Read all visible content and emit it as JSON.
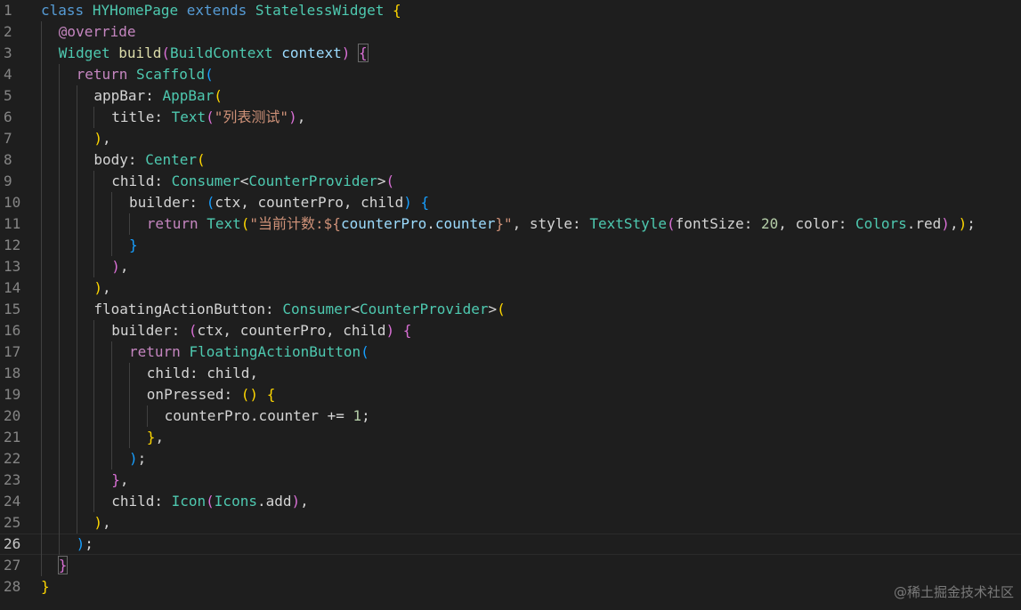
{
  "editor": {
    "language": "dart",
    "current_line": 26,
    "colors": {
      "background": "#1e1e1e",
      "keyword": "#569cd6",
      "control": "#c586c0",
      "type": "#4ec9b0",
      "function": "#dcdcaa",
      "parameter": "#9cdcfe",
      "string": "#ce9178",
      "number": "#b5cea8",
      "bracket_level_1": "#ffd700",
      "bracket_level_2": "#da70d6",
      "bracket_level_3": "#179fff"
    },
    "lines": [
      {
        "number": "1",
        "indent": 0,
        "tokens": [
          [
            "kw",
            "class"
          ],
          [
            "plain",
            " "
          ],
          [
            "type",
            "HYHomePage"
          ],
          [
            "plain",
            " "
          ],
          [
            "kw",
            "extends"
          ],
          [
            "plain",
            " "
          ],
          [
            "type",
            "StatelessWidget"
          ],
          [
            "plain",
            " "
          ],
          [
            "b1",
            "{"
          ]
        ]
      },
      {
        "number": "2",
        "indent": 1,
        "tokens": [
          [
            "ann",
            "@override"
          ]
        ]
      },
      {
        "number": "3",
        "indent": 1,
        "tokens": [
          [
            "type",
            "Widget"
          ],
          [
            "plain",
            " "
          ],
          [
            "fn",
            "build"
          ],
          [
            "b2",
            "("
          ],
          [
            "type",
            "BuildContext"
          ],
          [
            "plain",
            " "
          ],
          [
            "param",
            "context"
          ],
          [
            "b2",
            ")"
          ],
          [
            "plain",
            " "
          ],
          [
            "b2m",
            "{"
          ]
        ]
      },
      {
        "number": "4",
        "indent": 2,
        "tokens": [
          [
            "ctl",
            "return"
          ],
          [
            "plain",
            " "
          ],
          [
            "type",
            "Scaffold"
          ],
          [
            "b3",
            "("
          ]
        ]
      },
      {
        "number": "5",
        "indent": 3,
        "tokens": [
          [
            "plain",
            "appBar: "
          ],
          [
            "type",
            "AppBar"
          ],
          [
            "b1",
            "("
          ]
        ]
      },
      {
        "number": "6",
        "indent": 4,
        "tokens": [
          [
            "plain",
            "title: "
          ],
          [
            "type",
            "Text"
          ],
          [
            "b2",
            "("
          ],
          [
            "str",
            "\"列表测试\""
          ],
          [
            "b2",
            ")"
          ],
          [
            "plain",
            ","
          ]
        ]
      },
      {
        "number": "7",
        "indent": 3,
        "tokens": [
          [
            "b1",
            ")"
          ],
          [
            "plain",
            ","
          ]
        ]
      },
      {
        "number": "8",
        "indent": 3,
        "tokens": [
          [
            "plain",
            "body: "
          ],
          [
            "type",
            "Center"
          ],
          [
            "b1",
            "("
          ]
        ]
      },
      {
        "number": "9",
        "indent": 4,
        "tokens": [
          [
            "plain",
            "child: "
          ],
          [
            "type",
            "Consumer"
          ],
          [
            "plain",
            "<"
          ],
          [
            "type",
            "CounterProvider"
          ],
          [
            "plain",
            ">"
          ],
          [
            "b2",
            "("
          ]
        ]
      },
      {
        "number": "10",
        "indent": 5,
        "tokens": [
          [
            "plain",
            "builder: "
          ],
          [
            "b3",
            "("
          ],
          [
            "plain",
            "ctx, counterPro, child"
          ],
          [
            "b3",
            ")"
          ],
          [
            "plain",
            " "
          ],
          [
            "b3",
            "{"
          ]
        ]
      },
      {
        "number": "11",
        "indent": 6,
        "tokens": [
          [
            "ctl",
            "return"
          ],
          [
            "plain",
            " "
          ],
          [
            "type",
            "Text"
          ],
          [
            "b1",
            "("
          ],
          [
            "str",
            "\"当前计数:${"
          ],
          [
            "param",
            "counterPro"
          ],
          [
            "plain",
            "."
          ],
          [
            "param",
            "counter"
          ],
          [
            "str",
            "}\""
          ],
          [
            "plain",
            ", style: "
          ],
          [
            "type",
            "TextStyle"
          ],
          [
            "b2",
            "("
          ],
          [
            "plain",
            "fontSize: "
          ],
          [
            "num",
            "20"
          ],
          [
            "plain",
            ", color: "
          ],
          [
            "type",
            "Colors"
          ],
          [
            "plain",
            ".red"
          ],
          [
            "b2",
            ")"
          ],
          [
            "plain",
            ","
          ],
          [
            "b1",
            ")"
          ],
          [
            "plain",
            ";"
          ]
        ]
      },
      {
        "number": "12",
        "indent": 5,
        "tokens": [
          [
            "b3",
            "}"
          ]
        ]
      },
      {
        "number": "13",
        "indent": 4,
        "tokens": [
          [
            "b2",
            ")"
          ],
          [
            "plain",
            ","
          ]
        ]
      },
      {
        "number": "14",
        "indent": 3,
        "tokens": [
          [
            "b1",
            ")"
          ],
          [
            "plain",
            ","
          ]
        ]
      },
      {
        "number": "15",
        "indent": 3,
        "tokens": [
          [
            "plain",
            "floatingActionButton: "
          ],
          [
            "type",
            "Consumer"
          ],
          [
            "plain",
            "<"
          ],
          [
            "type",
            "CounterProvider"
          ],
          [
            "plain",
            ">"
          ],
          [
            "b1",
            "("
          ]
        ]
      },
      {
        "number": "16",
        "indent": 4,
        "tokens": [
          [
            "plain",
            "builder: "
          ],
          [
            "b2",
            "("
          ],
          [
            "plain",
            "ctx, counterPro, child"
          ],
          [
            "b2",
            ")"
          ],
          [
            "plain",
            " "
          ],
          [
            "b2",
            "{"
          ]
        ]
      },
      {
        "number": "17",
        "indent": 5,
        "tokens": [
          [
            "ctl",
            "return"
          ],
          [
            "plain",
            " "
          ],
          [
            "type",
            "FloatingActionButton"
          ],
          [
            "b3",
            "("
          ]
        ]
      },
      {
        "number": "18",
        "indent": 6,
        "tokens": [
          [
            "plain",
            "child: child,"
          ]
        ]
      },
      {
        "number": "19",
        "indent": 6,
        "tokens": [
          [
            "plain",
            "onPressed: "
          ],
          [
            "b1",
            "("
          ],
          [
            "b1",
            ")"
          ],
          [
            "plain",
            " "
          ],
          [
            "b1",
            "{"
          ]
        ]
      },
      {
        "number": "20",
        "indent": 7,
        "tokens": [
          [
            "plain",
            "counterPro.counter += "
          ],
          [
            "num",
            "1"
          ],
          [
            "plain",
            ";"
          ]
        ]
      },
      {
        "number": "21",
        "indent": 6,
        "tokens": [
          [
            "b1",
            "}"
          ],
          [
            "plain",
            ","
          ]
        ]
      },
      {
        "number": "22",
        "indent": 5,
        "tokens": [
          [
            "b3",
            ")"
          ],
          [
            "plain",
            ";"
          ]
        ]
      },
      {
        "number": "23",
        "indent": 4,
        "tokens": [
          [
            "b2",
            "}"
          ],
          [
            "plain",
            ","
          ]
        ]
      },
      {
        "number": "24",
        "indent": 4,
        "tokens": [
          [
            "plain",
            "child: "
          ],
          [
            "type",
            "Icon"
          ],
          [
            "b2",
            "("
          ],
          [
            "type",
            "Icons"
          ],
          [
            "plain",
            ".add"
          ],
          [
            "b2",
            ")"
          ],
          [
            "plain",
            ","
          ]
        ]
      },
      {
        "number": "25",
        "indent": 3,
        "tokens": [
          [
            "b1",
            ")"
          ],
          [
            "plain",
            ","
          ]
        ]
      },
      {
        "number": "26",
        "indent": 2,
        "tokens": [
          [
            "b3",
            ")"
          ],
          [
            "plain",
            ";"
          ]
        ]
      },
      {
        "number": "27",
        "indent": 1,
        "tokens": [
          [
            "b2m",
            "}"
          ]
        ]
      },
      {
        "number": "28",
        "indent": 0,
        "tokens": [
          [
            "b1",
            "}"
          ]
        ]
      }
    ]
  },
  "watermark": "@稀土掘金技术社区"
}
